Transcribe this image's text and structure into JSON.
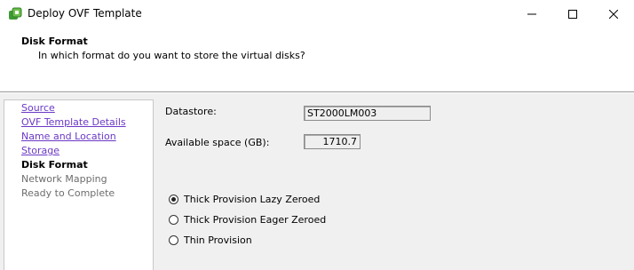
{
  "window": {
    "title": "Deploy OVF Template",
    "controls": [
      "minimize",
      "maximize",
      "close"
    ]
  },
  "header": {
    "title": "Disk Format",
    "subtitle": "In which format do you want to store the virtual disks?"
  },
  "steps": [
    {
      "label": "Source",
      "state": "completed"
    },
    {
      "label": "OVF Template Details",
      "state": "completed"
    },
    {
      "label": "Name and Location",
      "state": "completed"
    },
    {
      "label": "Storage",
      "state": "completed"
    },
    {
      "label": "Disk Format",
      "state": "current"
    },
    {
      "label": "Network Mapping",
      "state": "pending"
    },
    {
      "label": "Ready to Complete",
      "state": "pending"
    }
  ],
  "form": {
    "datastore_label": "Datastore:",
    "datastore_value": "ST2000LM003",
    "space_label": "Available space (GB):",
    "space_value": "1710.7"
  },
  "provisioning": {
    "selected": "Thick Provision Lazy Zeroed",
    "options": [
      "Thick Provision Lazy Zeroed",
      "Thick Provision Eager Zeroed",
      "Thin Provision"
    ]
  },
  "colors": {
    "link": "#6b39c6",
    "pending": "#6d6d6d",
    "app_icon": "#4aa23a"
  }
}
